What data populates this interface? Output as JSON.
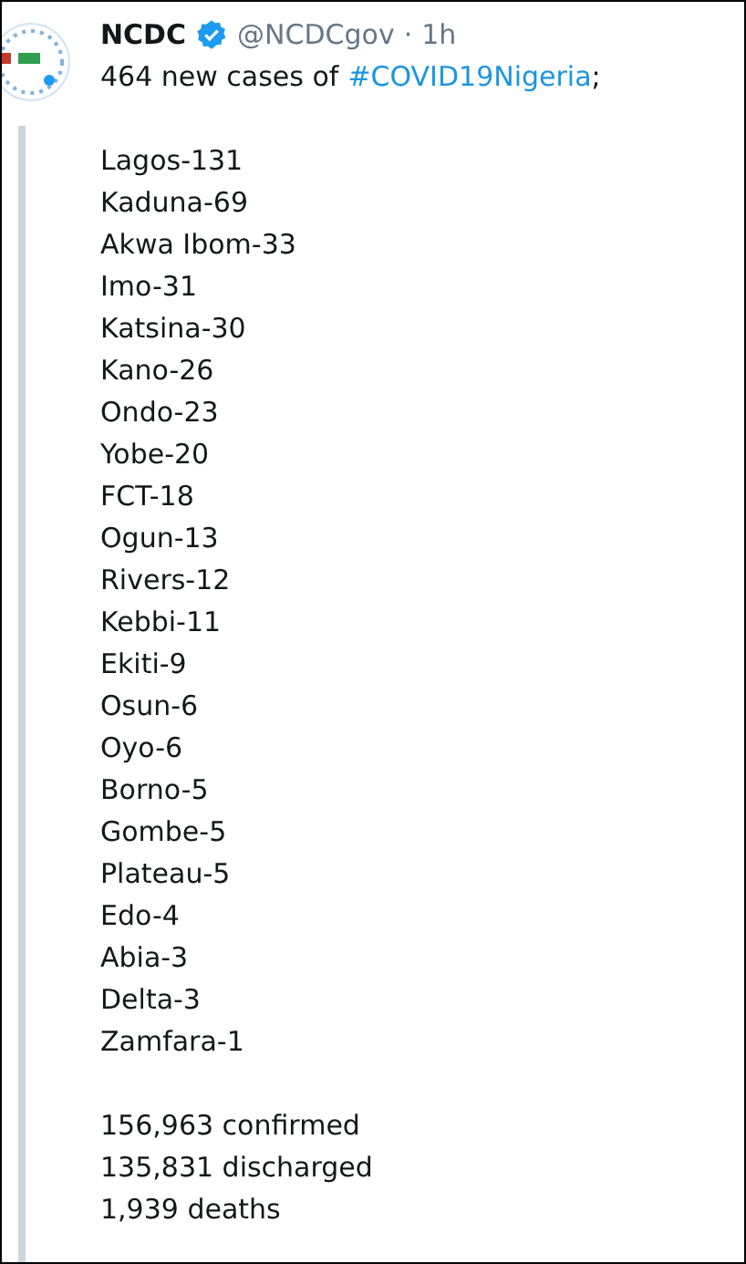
{
  "author": {
    "name": "NCDC",
    "verified": true,
    "handle": "@NCDCgov",
    "separator": "·",
    "time": "1h"
  },
  "intro": {
    "text": "464 new cases of",
    "hashtag": "#COVID19Nigeria",
    "end": ";"
  },
  "states": [
    "Lagos-131",
    "Kaduna-69",
    "Akwa Ibom-33",
    "Imo-31",
    "Katsina-30",
    "Kano-26",
    "Ondo-23",
    "Yobe-20",
    "FCT-18",
    "Ogun-13",
    "Rivers-12",
    "Kebbi-11",
    "Ekiti-9",
    "Osun-6",
    "Oyo-6",
    "Borno-5",
    "Gombe-5",
    "Plateau-5",
    "Edo-4",
    "Abia-3",
    "Delta-3",
    "Zamfara-1"
  ],
  "totals": [
    "156,963 confirmed",
    "135,831 discharged",
    "1,939 deaths"
  ]
}
